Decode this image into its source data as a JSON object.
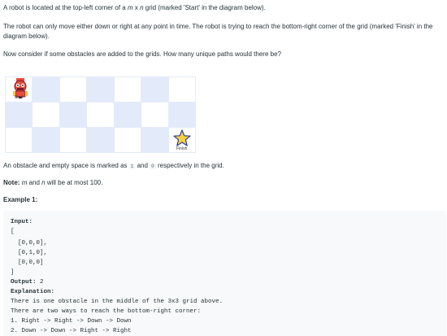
{
  "intro": {
    "p1_before": "A robot is located at the top-left corner of a ",
    "p1_m": "m",
    "p1_x": " x ",
    "p1_n": "n",
    "p1_after": " grid (marked 'Start' in the diagram below).",
    "p2": "The robot can only move either down or right at any point in time. The robot is trying to reach the bottom-right corner of the grid (marked 'Finish' in the diagram below).",
    "p3": "Now consider if some obstacles are added to the grids. How many unique paths would there be?"
  },
  "diagram": {
    "start_label": "Start",
    "finish_label": "Finish",
    "colors": {
      "blue_cell": "#e3ebfa",
      "star_fill": "#f4d03f",
      "star_stroke": "#2d3ea0"
    }
  },
  "note_text": {
    "obstacle_before": "An obstacle and empty space is marked as ",
    "obstacle_one": "1",
    "obstacle_and": " and ",
    "obstacle_zero": "0",
    "obstacle_after": " respectively in the grid.",
    "note_label": "Note:",
    "note_m": "m",
    "note_and": " and ",
    "note_n": "n",
    "note_after": " will be at most 100."
  },
  "example": {
    "title": "Example 1:",
    "lines": [
      {
        "text": "Input:",
        "bold": true
      },
      {
        "text": "[",
        "bold": false
      },
      {
        "text": "  [0,0,0],",
        "bold": false
      },
      {
        "text": "  [0,1,0],",
        "bold": false
      },
      {
        "text": "  [0,0,0]",
        "bold": false
      },
      {
        "text": "]",
        "bold": false
      },
      {
        "text": "Output:",
        "bold": true,
        "rest": " 2"
      },
      {
        "text": "Explanation:",
        "bold": true
      },
      {
        "text": "There is one obstacle in the middle of the 3x3 grid above.",
        "bold": false
      },
      {
        "text": "There are two ways to reach the bottom-right corner:",
        "bold": false
      },
      {
        "text": "1. Right -> Right -> Down -> Down",
        "bold": false
      },
      {
        "text": "2. Down -> Down -> Right -> Right",
        "bold": false
      }
    ]
  }
}
